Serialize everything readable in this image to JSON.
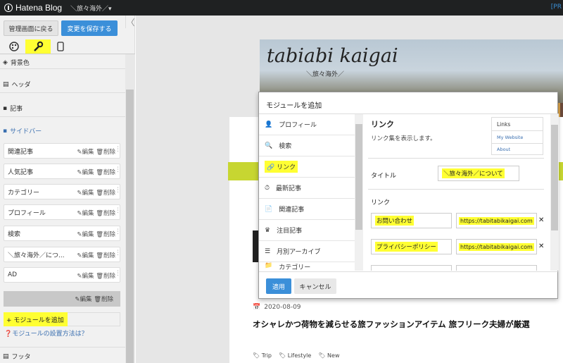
{
  "topbar": {
    "logo": "Hatena Blog",
    "blog_name": "＼旅々海外／▾",
    "pr": "[PR"
  },
  "sidebar": {
    "back_label": "管理画面に戻る",
    "save_label": "変更を保存する",
    "collapse": "〈",
    "sections": {
      "bg_color": "背景色",
      "header": "ヘッダ",
      "article": "記事",
      "sidebar": "サイドバー",
      "footer": "フッタ"
    },
    "items": [
      {
        "label": "関連記事",
        "edit": "✎編集",
        "delete": "🗑削除"
      },
      {
        "label": "人気記事",
        "edit": "✎編集",
        "delete": "🗑削除"
      },
      {
        "label": "カテゴリー",
        "edit": "✎編集",
        "delete": "🗑削除"
      },
      {
        "label": "プロフィール",
        "edit": "✎編集",
        "delete": "🗑削除"
      },
      {
        "label": "検索",
        "edit": "✎編集",
        "delete": "🗑削除"
      },
      {
        "label": "＼旅々海外／につ...",
        "edit": "✎編集",
        "delete": "🗑削除"
      },
      {
        "label": "AD",
        "edit": "✎編集",
        "delete": "🗑削除"
      }
    ],
    "dark_item": "✎編集 🗑削除",
    "add_module": "+ モジュールを追加",
    "howto": "❓モジュールの設置方法は？"
  },
  "blog": {
    "header_title": "tabiabi kaigai",
    "header_sub": "＼旅々海外／",
    "date": "2020-08-09",
    "post_title": "オシャレかつ荷物を減らせる旅ファッションアイテム 旅フリーク夫婦が厳選",
    "tags": [
      "Trip",
      "Lifestyle",
      "New"
    ]
  },
  "modal": {
    "title": "モジュールを追加",
    "modules": [
      "プロフィール",
      "検索",
      "リンク",
      "最新記事",
      "関連記事",
      "注目記事",
      "月別アーカイブ",
      "カテゴリー"
    ],
    "link_title": "リンク",
    "link_desc": "リンク集を表示します。",
    "preview": {
      "title": "Links",
      "links": [
        "My Website",
        "About"
      ]
    },
    "title_label": "タイトル",
    "title_value": "＼旅々海外／について",
    "links_label": "リンク",
    "rows": [
      {
        "name": "お問い合わせ",
        "url": "https://tabitabikaigai.com"
      },
      {
        "name": "プライバシーポリシー",
        "url": "https://tabitabikaigai.com"
      }
    ],
    "apply": "適用",
    "cancel": "キャンセル"
  }
}
